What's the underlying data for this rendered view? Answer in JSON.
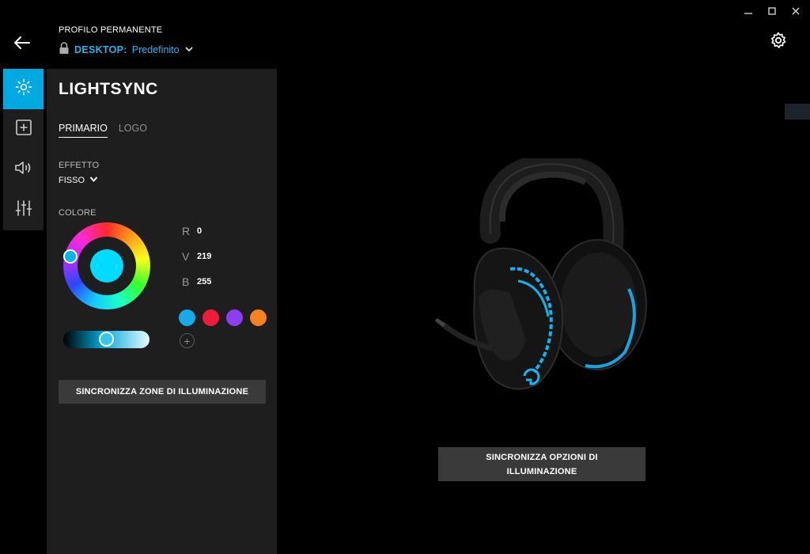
{
  "window": {
    "controls": [
      "minimize",
      "maximize",
      "close"
    ]
  },
  "header": {
    "profile_title": "PROFILO PERMANENTE",
    "profile_device": "DESKTOP:",
    "profile_name": "Predefinito"
  },
  "rail": {
    "items": [
      {
        "icon": "sun-icon",
        "active": true
      },
      {
        "icon": "plus-square-icon",
        "active": false
      },
      {
        "icon": "speaker-icon",
        "active": false
      },
      {
        "icon": "equalizer-icon",
        "active": false
      }
    ]
  },
  "panel": {
    "title": "LIGHTSYNC",
    "tabs": [
      {
        "label": "PRIMARIO",
        "active": true
      },
      {
        "label": "LOGO",
        "active": false
      }
    ],
    "effect_label": "EFFETTO",
    "effect_value": "FISSO",
    "color_label": "COLORE",
    "rgb": {
      "r_label": "R",
      "r_value": "0",
      "g_label": "V",
      "g_value": "219",
      "b_label": "B",
      "b_value": "255"
    },
    "selected_color": "#00dbff",
    "brightness_fraction": 0.5,
    "swatches": [
      "#18a9e6",
      "#ee1c3a",
      "#8c3ef0",
      "#f58220"
    ],
    "sync_zones_label": "SINCRONIZZA ZONE DI ILLUMINAZIONE"
  },
  "main": {
    "sync_options_line1": "SINCRONIZZA OPZIONI DI",
    "sync_options_line2": "ILLUMINAZIONE"
  },
  "colors": {
    "accent": "#00a9e0",
    "panel_bg": "#1e1e1e",
    "button_bg": "#3a3a3a",
    "background": "#000000"
  }
}
